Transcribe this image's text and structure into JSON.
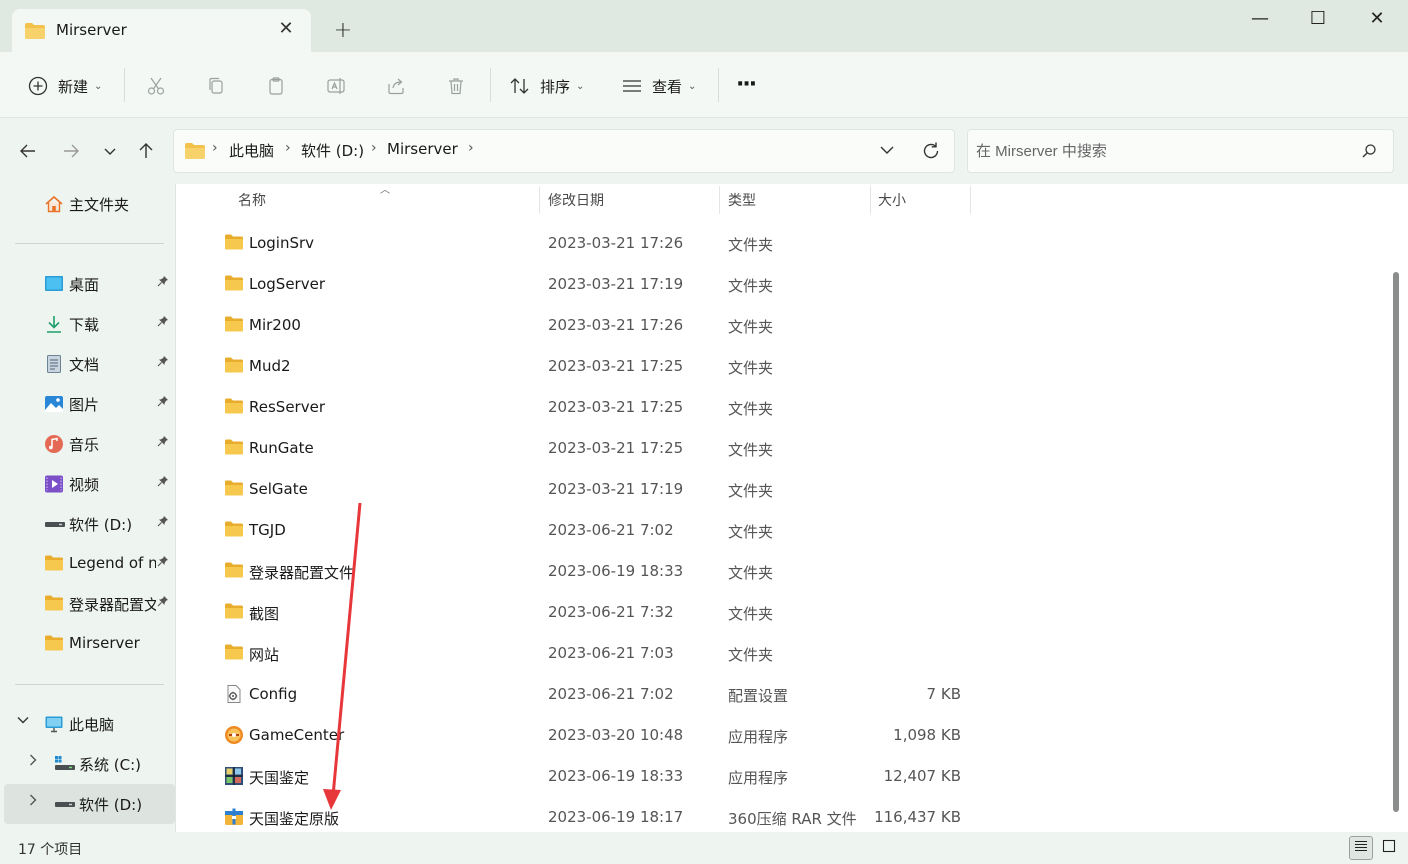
{
  "tab": {
    "title": "Mirserver",
    "close": "✕",
    "new": "+"
  },
  "window": {
    "minimize": "—",
    "maximize": "☐",
    "close": "✕"
  },
  "toolbar": {
    "new_label": "新建",
    "sort_label": "排序",
    "view_label": "查看",
    "more_label": "···"
  },
  "address": {
    "crumbs": [
      "此电脑",
      "软件 (D:)",
      "Mirserver"
    ],
    "search_placeholder": "在 Mirserver 中搜索"
  },
  "sidebar": {
    "home": "主文件夹",
    "quick": [
      {
        "label": "桌面",
        "icon": "desktop-icon"
      },
      {
        "label": "下载",
        "icon": "download-icon"
      },
      {
        "label": "文档",
        "icon": "document-icon"
      },
      {
        "label": "图片",
        "icon": "picture-icon"
      },
      {
        "label": "音乐",
        "icon": "music-icon"
      },
      {
        "label": "视频",
        "icon": "video-icon"
      },
      {
        "label": "软件 (D:)",
        "icon": "drive-icon"
      },
      {
        "label": "Legend of n",
        "icon": "folder-icon"
      },
      {
        "label": "登录器配置文",
        "icon": "folder-icon"
      },
      {
        "label": "Mirserver",
        "icon": "folder-icon"
      }
    ],
    "this_pc": "此电脑",
    "drives": [
      {
        "label": "系统 (C:)"
      },
      {
        "label": "软件 (D:)"
      }
    ]
  },
  "columns": {
    "name": "名称",
    "date": "修改日期",
    "type": "类型",
    "size": "大小"
  },
  "files": [
    {
      "name": "LoginSrv",
      "date": "2023-03-21 17:26",
      "type": "文件夹",
      "size": "",
      "icon": "folder-icon"
    },
    {
      "name": "LogServer",
      "date": "2023-03-21 17:19",
      "type": "文件夹",
      "size": "",
      "icon": "folder-icon"
    },
    {
      "name": "Mir200",
      "date": "2023-03-21 17:26",
      "type": "文件夹",
      "size": "",
      "icon": "folder-icon"
    },
    {
      "name": "Mud2",
      "date": "2023-03-21 17:25",
      "type": "文件夹",
      "size": "",
      "icon": "folder-icon"
    },
    {
      "name": "ResServer",
      "date": "2023-03-21 17:25",
      "type": "文件夹",
      "size": "",
      "icon": "folder-icon"
    },
    {
      "name": "RunGate",
      "date": "2023-03-21 17:25",
      "type": "文件夹",
      "size": "",
      "icon": "folder-icon"
    },
    {
      "name": "SelGate",
      "date": "2023-03-21 17:19",
      "type": "文件夹",
      "size": "",
      "icon": "folder-icon"
    },
    {
      "name": "TGJD",
      "date": "2023-06-21 7:02",
      "type": "文件夹",
      "size": "",
      "icon": "folder-icon"
    },
    {
      "name": "登录器配置文件",
      "date": "2023-06-19 18:33",
      "type": "文件夹",
      "size": "",
      "icon": "folder-icon"
    },
    {
      "name": "截图",
      "date": "2023-06-21 7:32",
      "type": "文件夹",
      "size": "",
      "icon": "folder-icon"
    },
    {
      "name": "网站",
      "date": "2023-06-21 7:03",
      "type": "文件夹",
      "size": "",
      "icon": "folder-icon"
    },
    {
      "name": "Config",
      "date": "2023-06-21 7:02",
      "type": "配置设置",
      "size": "7 KB",
      "icon": "config-file-icon"
    },
    {
      "name": "GameCenter",
      "date": "2023-03-20 10:48",
      "type": "应用程序",
      "size": "1,098 KB",
      "icon": "game-app-icon"
    },
    {
      "name": "天国鉴定",
      "date": "2023-06-19 18:33",
      "type": "应用程序",
      "size": "12,407 KB",
      "icon": "app-icon"
    },
    {
      "name": "天国鉴定原版",
      "date": "2023-06-19 18:17",
      "type": "360压缩 RAR 文件",
      "size": "116,437 KB",
      "icon": "rar-archive-icon"
    }
  ],
  "status": {
    "count": "17 个项目"
  },
  "colors": {
    "folder": "#f2c24d",
    "accent": "#0067c0",
    "annotation_arrow": "#e8373a"
  }
}
